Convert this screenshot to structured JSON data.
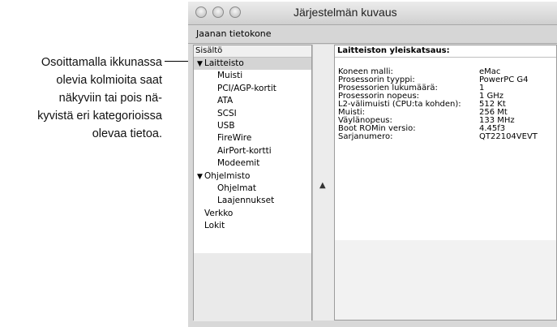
{
  "callout": {
    "lines": [
      "Osoittamalla ikkunassa",
      "olevia kolmioita saat",
      "näkyviin tai pois nä-",
      "kyvistä eri kategorioissa",
      "olevaa tietoa."
    ]
  },
  "window": {
    "title": "Järjestelmän kuvaus",
    "toolbar_label": "Jaanan tietokone"
  },
  "sidebar": {
    "header": "Sisältö",
    "items": [
      {
        "label": "Laitteisto",
        "level": 0,
        "expanded": true,
        "selected": true
      },
      {
        "label": "Muisti",
        "level": 1
      },
      {
        "label": "PCI/AGP-kortit",
        "level": 1
      },
      {
        "label": "ATA",
        "level": 1
      },
      {
        "label": "SCSI",
        "level": 1
      },
      {
        "label": "USB",
        "level": 1
      },
      {
        "label": "FireWire",
        "level": 1
      },
      {
        "label": "AirPort-kortti",
        "level": 1
      },
      {
        "label": "Modeemit",
        "level": 1
      },
      {
        "label": "Ohjelmisto",
        "level": 0,
        "expanded": true
      },
      {
        "label": "Ohjelmat",
        "level": 1
      },
      {
        "label": "Laajennukset",
        "level": 1
      },
      {
        "label": "Verkko",
        "level": 0
      },
      {
        "label": "Lokit",
        "level": 0
      }
    ]
  },
  "details": {
    "header": "Laitteiston yleiskatsaus:",
    "rows": [
      {
        "key": "Koneen malli:",
        "value": "eMac"
      },
      {
        "key": "Prosessorin tyyppi:",
        "value": "PowerPC G4"
      },
      {
        "key": "Prosessorien lukumäärä:",
        "value": "1"
      },
      {
        "key": "Prosessorin nopeus:",
        "value": "1 GHz"
      },
      {
        "key": "L2-välimuisti (CPU:ta kohden):",
        "value": "512 Kt"
      },
      {
        "key": "Muisti:",
        "value": "256 Mt"
      },
      {
        "key": "Väylänopeus:",
        "value": "133 MHz"
      },
      {
        "key": "Boot ROMin versio:",
        "value": "4.45f3"
      },
      {
        "key": "Sarjanumero:",
        "value": "QT22104VEVT"
      }
    ]
  },
  "icons": {
    "disclosure_expanded": "triangle-down-icon",
    "splitter_handle": "caret-up-icon"
  }
}
